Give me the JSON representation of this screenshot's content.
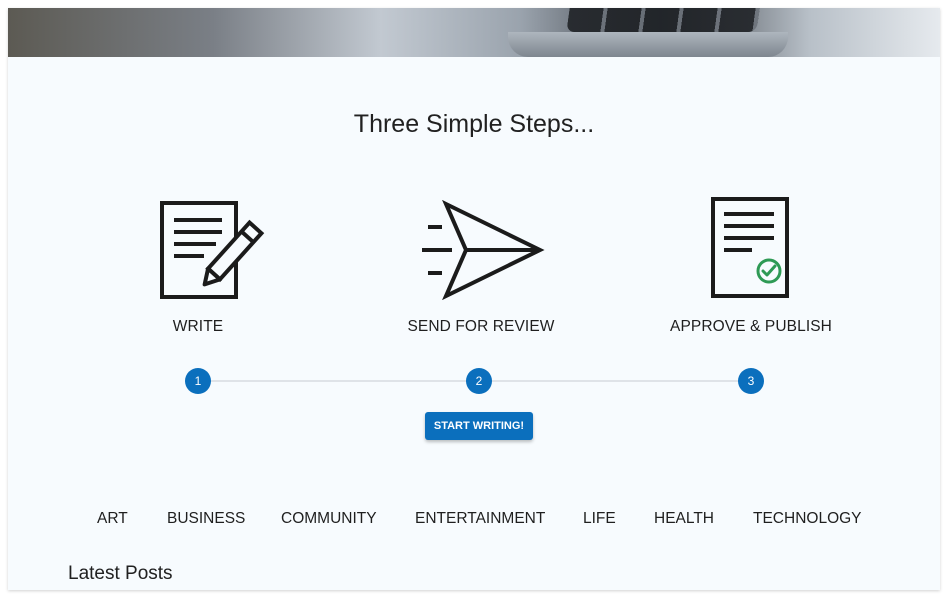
{
  "hero": {
    "image": "laptop-keyboard-photo"
  },
  "section": {
    "title": "Three Simple Steps..."
  },
  "steps": [
    {
      "label": "WRITE",
      "number": "1",
      "icon": "document-pencil-icon"
    },
    {
      "label": "SEND FOR REVIEW",
      "number": "2",
      "icon": "paper-plane-icon"
    },
    {
      "label": "APPROVE & PUBLISH",
      "number": "3",
      "icon": "document-check-icon"
    }
  ],
  "cta": {
    "label": "START WRITING!"
  },
  "categories": [
    "ART",
    "BUSINESS",
    "COMMUNITY",
    "ENTERTAINMENT",
    "LIFE",
    "HEALTH",
    "TECHNOLOGY"
  ],
  "latest": {
    "heading": "Latest Posts"
  },
  "colors": {
    "accent": "#0b6fbd",
    "check": "#2e9a55",
    "background": "#f7fbfe"
  }
}
